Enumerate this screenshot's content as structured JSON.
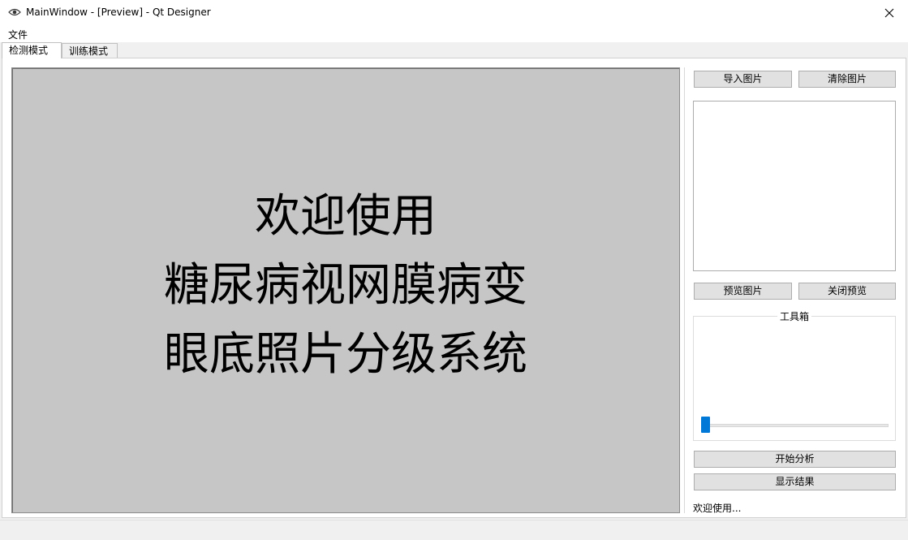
{
  "window": {
    "title": "MainWindow - [Preview] - Qt Designer",
    "icon": "eye-icon",
    "close_glyph": "✕"
  },
  "menubar": {
    "file_label": "文件"
  },
  "tabs": [
    {
      "label": "检测模式",
      "active": true
    },
    {
      "label": "训练模式",
      "active": false
    }
  ],
  "display": {
    "line1": "欢迎使用",
    "line2": "糖尿病视网膜病变",
    "line3": "眼底照片分级系统"
  },
  "controls": {
    "import_label": "导入图片",
    "clear_label": "清除图片",
    "preview_label": "预览图片",
    "close_preview_label": "关闭预览",
    "toolbox_title": "工具箱",
    "slider_value": 0,
    "analyze_label": "开始分析",
    "show_result_label": "显示结果",
    "status_text": "欢迎使用..."
  },
  "colors": {
    "display_bg": "#c6c6c6",
    "slider_handle": "#0078d7",
    "button_bg": "#e1e1e1"
  }
}
